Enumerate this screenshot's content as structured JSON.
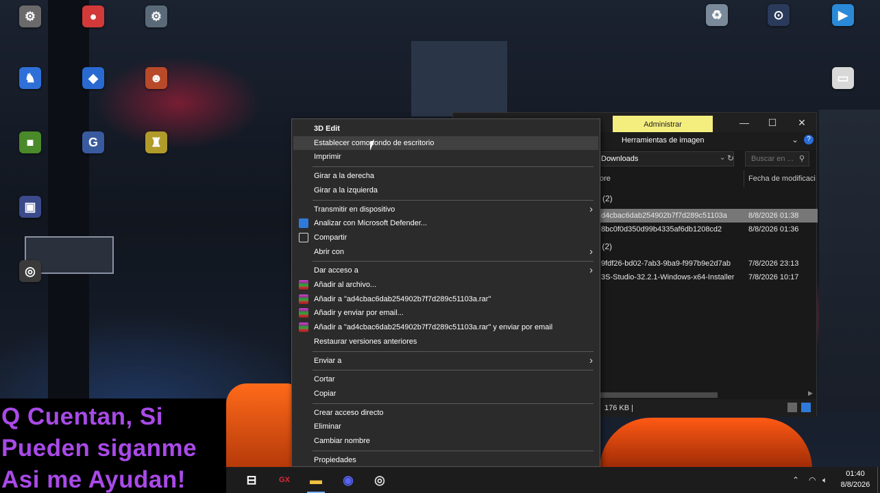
{
  "colors": {
    "overlay_text": "#a94ae8",
    "admin_tab_bg": "#f4ee7f",
    "selected_row": "#777777",
    "menu_bg": "#2b2b2b",
    "taskbar_bg": "#1c1c1c"
  },
  "desktop_icons": [
    {
      "name": "desktop-icon-1",
      "icon": "app-icon",
      "color": "#6a6a6a",
      "glyph": "⚙"
    },
    {
      "name": "desktop-icon-2",
      "icon": "app-icon",
      "color": "#d23a3a",
      "glyph": "●"
    },
    {
      "name": "desktop-icon-3",
      "icon": "app-icon",
      "color": "#5a6a78",
      "glyph": "⚙"
    },
    {
      "name": "desktop-icon-4",
      "icon": "game-icon",
      "color": "#2f6fd8",
      "glyph": "♞"
    },
    {
      "name": "desktop-icon-5",
      "icon": "roblox-studio-icon",
      "color": "#2a6ad0",
      "glyph": "◆"
    },
    {
      "name": "desktop-icon-6",
      "icon": "game-icon",
      "color": "#b84a2a",
      "glyph": "☻"
    },
    {
      "name": "desktop-icon-7",
      "icon": "minecraft-icon",
      "color": "#4a8a2a",
      "glyph": "■"
    },
    {
      "name": "desktop-icon-8",
      "icon": "game-icon",
      "color": "#3a5aa0",
      "glyph": "G"
    },
    {
      "name": "desktop-icon-9",
      "icon": "game-icon",
      "color": "#b09a2a",
      "glyph": "♜"
    },
    {
      "name": "desktop-icon-10",
      "icon": "app-icon",
      "color": "#3a4a8a",
      "glyph": "▣"
    },
    {
      "name": "desktop-icon-11",
      "icon": "obs-icon",
      "color": "#3a3a3a",
      "glyph": "◎"
    },
    {
      "name": "desktop-icon-12",
      "icon": "recycle-bin-icon",
      "color": "#7a8a9a",
      "glyph": "♻"
    },
    {
      "name": "desktop-icon-13",
      "icon": "steam-icon",
      "color": "#2a3a5a",
      "glyph": "⊙"
    },
    {
      "name": "desktop-icon-14",
      "icon": "play-store-icon",
      "color": "#2a8ad8",
      "glyph": "▶"
    },
    {
      "name": "desktop-icon-15",
      "icon": "folder-icon",
      "color": "#d8d8d8",
      "glyph": "▭"
    }
  ],
  "explorer": {
    "admin_tab": "Administrar",
    "ribbon_tab": "Herramientas de imagen",
    "address": "Downloads",
    "search_placeholder": "Buscar en ...",
    "col_name": "ore",
    "col_date": "Fecha de modificaci",
    "group1": "(2)",
    "group2": "r (2)",
    "files": [
      {
        "name": "d4cbac6dab254902b7f7d289c51103a",
        "date": "8/8/2026 01:38",
        "selected": true
      },
      {
        "name": "8bc0f0d350d99b4335af6db1208cd2",
        "date": "8/8/2026 01:36",
        "selected": false
      },
      {
        "name": "9fdf26-bd02-7ab3-9ba9-f997b9e2d7ab",
        "date": "7/8/2026 23:13",
        "selected": false
      },
      {
        "name": "3S-Studio-32.2.1-Windows-x64-Installer",
        "date": "7/8/2026 10:17",
        "selected": false
      }
    ],
    "status_size": "176 KB  |"
  },
  "context_menu": {
    "items": [
      {
        "label": "3D Edit",
        "bold": true
      },
      {
        "label": "Establecer como fondo de escritorio",
        "hover": true
      },
      {
        "label": "Imprimir"
      },
      {
        "sep": true
      },
      {
        "label": "Girar a la derecha"
      },
      {
        "label": "Girar a la izquierda"
      },
      {
        "sep": true
      },
      {
        "label": "Transmitir en dispositivo",
        "submenu": true
      },
      {
        "label": "Analizar con Microsoft Defender...",
        "icon": "defender-icon"
      },
      {
        "label": "Compartir",
        "icon": "share-icon"
      },
      {
        "label": "Abrir con",
        "submenu": true
      },
      {
        "sep": true
      },
      {
        "label": "Dar acceso a",
        "submenu": true
      },
      {
        "label": "Añadir al archivo...",
        "icon": "winrar-icon"
      },
      {
        "label": "Añadir a \"ad4cbac6dab254902b7f7d289c51103a.rar\"",
        "icon": "winrar-icon"
      },
      {
        "label": "Añadir y enviar por email...",
        "icon": "winrar-icon"
      },
      {
        "label": "Añadir a \"ad4cbac6dab254902b7f7d289c51103a.rar\" y enviar por email",
        "icon": "winrar-icon"
      },
      {
        "label": "Restaurar versiones anteriores"
      },
      {
        "sep": true
      },
      {
        "label": "Enviar a",
        "submenu": true
      },
      {
        "sep": true
      },
      {
        "label": "Cortar"
      },
      {
        "label": "Copiar"
      },
      {
        "sep": true
      },
      {
        "label": "Crear acceso directo"
      },
      {
        "label": "Eliminar"
      },
      {
        "label": "Cambiar nombre"
      },
      {
        "sep": true
      },
      {
        "label": "Propiedades"
      }
    ]
  },
  "overlay": {
    "line1": "Q Cuentan, Si",
    "line2": "Pueden siganme",
    "line3": "Asi me Ayudan!"
  },
  "taskbar": {
    "apps": [
      {
        "name": "task-view-button",
        "icon": "task-view-icon",
        "glyph": "⊟",
        "color": "#ffffff",
        "active": false
      },
      {
        "name": "opera-gx-button",
        "icon": "opera-gx-icon",
        "glyph": "GX",
        "color": "#e0283a",
        "active": false
      },
      {
        "name": "file-explorer-button",
        "icon": "folder-icon",
        "glyph": "▬",
        "color": "#f0c040",
        "active": true
      },
      {
        "name": "discord-button",
        "icon": "discord-icon",
        "glyph": "◉",
        "color": "#5865f2",
        "active": false
      },
      {
        "name": "obs-button",
        "icon": "obs-icon",
        "glyph": "◎",
        "color": "#dddddd",
        "active": false
      }
    ],
    "time": "01:40",
    "date": "8/8/2026"
  }
}
